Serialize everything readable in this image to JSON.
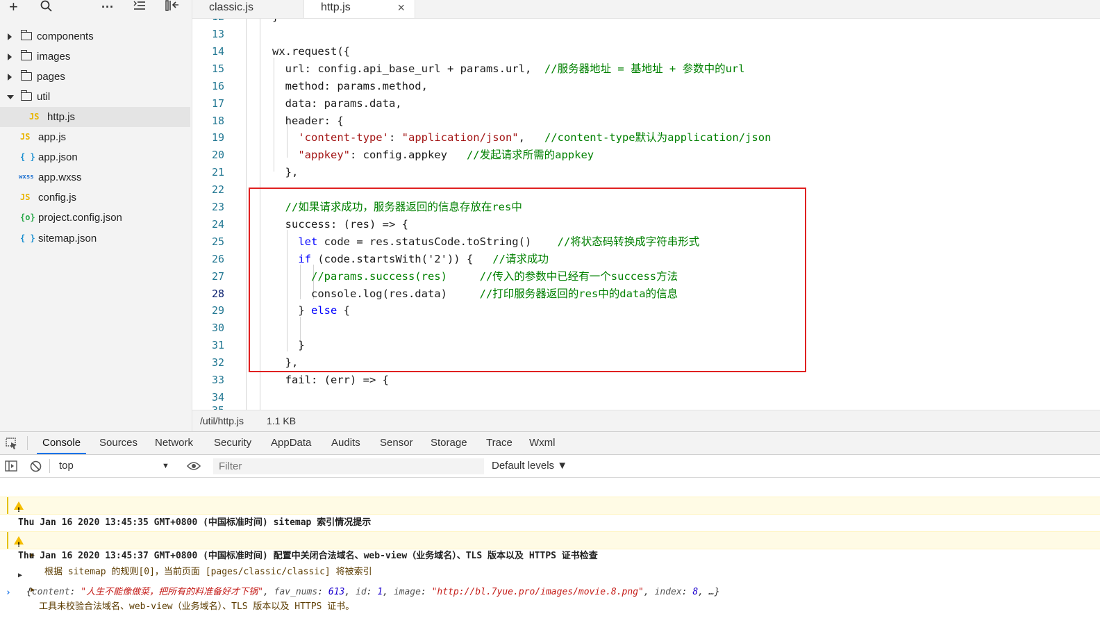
{
  "sidebar": {
    "toolbar_icons": [
      "plus-icon",
      "search-icon",
      "more-icon",
      "outline-icon",
      "collapse-icon"
    ],
    "tree": [
      {
        "label": "components",
        "type": "folder",
        "expanded": false
      },
      {
        "label": "images",
        "type": "folder",
        "expanded": false
      },
      {
        "label": "pages",
        "type": "folder",
        "expanded": false
      },
      {
        "label": "util",
        "type": "folder",
        "expanded": true
      },
      {
        "label": "http.js",
        "type": "js",
        "badge": "JS",
        "selected": true
      },
      {
        "label": "app.js",
        "type": "js",
        "badge": "JS"
      },
      {
        "label": "app.json",
        "type": "json",
        "badge": "{ }"
      },
      {
        "label": "app.wxss",
        "type": "wxss",
        "badge": "wxss"
      },
      {
        "label": "config.js",
        "type": "js",
        "badge": "JS"
      },
      {
        "label": "project.config.json",
        "type": "config",
        "badge": "{o}"
      },
      {
        "label": "sitemap.json",
        "type": "json",
        "badge": "{ }"
      }
    ]
  },
  "tabs": [
    {
      "label": "classic.js",
      "active": false
    },
    {
      "label": "http.js",
      "active": true,
      "close": "×"
    }
  ],
  "editor": {
    "partial_top_line": "}",
    "partial_top_number": "12",
    "lines": [
      {
        "n": "13",
        "code": ""
      },
      {
        "n": "14",
        "code": "wx.request({"
      },
      {
        "n": "15",
        "code": "  url: config.api_base_url + params.url,  ",
        "comment": "//服务器地址 = 基地址 + 参数中的url"
      },
      {
        "n": "16",
        "code": "  method: params.method,"
      },
      {
        "n": "17",
        "code": "  data: params.data,"
      },
      {
        "n": "18",
        "code": "  header: {"
      },
      {
        "n": "19",
        "pre": "    ",
        "s1": "'content-type'",
        "mid": ": ",
        "s2": "\"application/json\"",
        "post": ",   ",
        "comment": "//content-type默认为application/json"
      },
      {
        "n": "20",
        "pre": "    ",
        "s1": "\"appkey\"",
        "mid": ": config.appkey   ",
        "comment": "//发起请求所需的appkey"
      },
      {
        "n": "21",
        "code": "  },"
      },
      {
        "n": "22",
        "code": ""
      },
      {
        "n": "23",
        "pre": "  ",
        "comment": "//如果请求成功，服务器返回的信息存放在res中"
      },
      {
        "n": "24",
        "code": "  success: (res) => {"
      },
      {
        "n": "25",
        "pre": "    ",
        "kw": "let",
        "code": " code = res.statusCode.toString()    ",
        "comment": "//将状态码转换成字符串形式"
      },
      {
        "n": "26",
        "pre": "    ",
        "kw": "if",
        "code": " (code.startsWith('2')) {   ",
        "comment": "//请求成功"
      },
      {
        "n": "27",
        "pre": "      ",
        "comment": "//params.success(res)     //传入的参数中已经有一个success方法"
      },
      {
        "n": "28",
        "code": "      console.log(res.data)     ",
        "comment": "//打印服务器返回的res中的data的信息"
      },
      {
        "n": "29",
        "code": "    } ",
        "kw": "else",
        "post": " {"
      },
      {
        "n": "30",
        "code": ""
      },
      {
        "n": "31",
        "code": "    }"
      },
      {
        "n": "32",
        "code": "  },"
      },
      {
        "n": "33",
        "code": "  fail: (err) => {"
      },
      {
        "n": "34",
        "code": ""
      }
    ],
    "partial_bottom_number": "35"
  },
  "status": {
    "path": "/util/http.js",
    "size": "1.1 KB"
  },
  "devtools": {
    "tabs": [
      "Console",
      "Sources",
      "Network",
      "Security",
      "AppData",
      "Audits",
      "Sensor",
      "Storage",
      "Trace",
      "Wxml"
    ],
    "active_tab": "Console",
    "context": "top",
    "filter_placeholder": "Filter",
    "levels": "Default levels ▼",
    "logs": {
      "group1": "Thu Jan 16 2020 13:45:35 GMT+0800 (中国标准时间) sitemap 索引情况提示",
      "warn1": "根据 sitemap 的规则[0]，当前页面 [pages/classic/classic] 将被索引",
      "group2": "Thu Jan 16 2020 13:45:37 GMT+0800 (中国标准时间) 配置中关闭合法域名、web-view（业务域名）、TLS 版本以及 HTTPS 证书检查",
      "warn2": "工具未校验合法域名、web-view（业务域名）、TLS 版本以及 HTTPS 证书。",
      "obj": {
        "k1": "content",
        "v1": "\"人生不能像做菜，把所有的料准备好才下锅\"",
        "k2": "fav_nums",
        "v2": "613",
        "k3": "id",
        "v3": "1",
        "k4": "image",
        "v4": "\"http://bl.7yue.pro/images/movie.8.png\"",
        "k5": "index",
        "v5": "8",
        "tail": "…}"
      }
    }
  },
  "colors": {
    "highlight_border": "#e02020",
    "keyword": "#0000ff",
    "string": "#a31515",
    "comment": "#008000",
    "line_number": "#237893"
  }
}
